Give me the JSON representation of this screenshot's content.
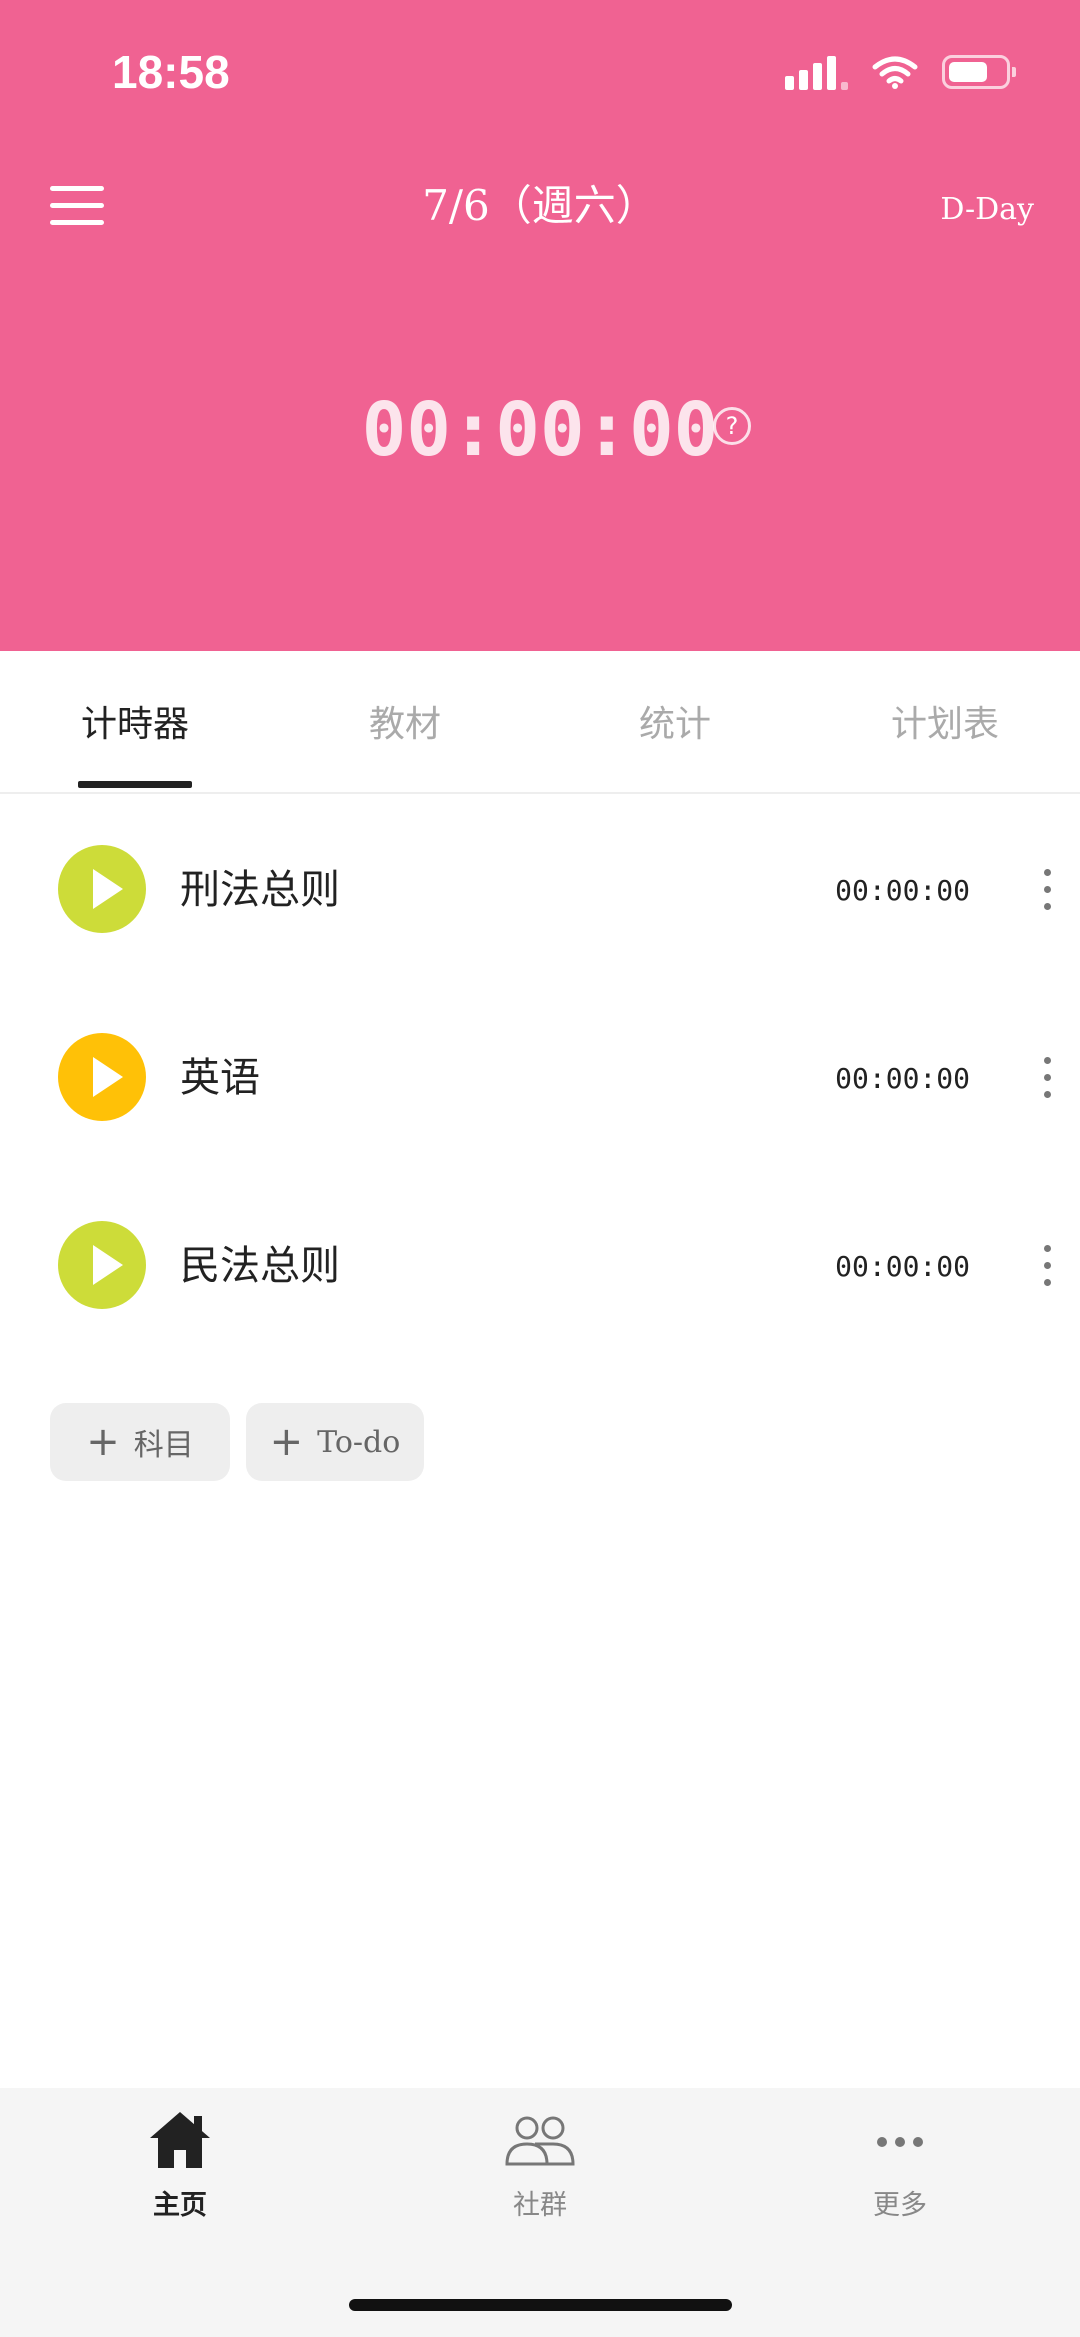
{
  "status_bar": {
    "time": "18:58"
  },
  "header": {
    "date_title": "7/6（週六）",
    "dday_label": "D-Day",
    "timer": "00:00:00",
    "help_symbol": "?",
    "background_color": "#F06292"
  },
  "tabs": [
    {
      "label": "计時器",
      "active": true
    },
    {
      "label": "教材",
      "active": false
    },
    {
      "label": "统计",
      "active": false
    },
    {
      "label": "计划表",
      "active": false
    }
  ],
  "subjects": [
    {
      "name": "刑法总则",
      "time": "00:00:00",
      "color": "#CDDC39"
    },
    {
      "name": "英语",
      "time": "00:00:00",
      "color": "#FFC107"
    },
    {
      "name": "民法总则",
      "time": "00:00:00",
      "color": "#CDDC39"
    }
  ],
  "actions": {
    "add_subject": "科目",
    "add_todo": "To-do",
    "plus_symbol": "+"
  },
  "bottom_nav": [
    {
      "label": "主页",
      "icon": "home-icon",
      "active": true
    },
    {
      "label": "社群",
      "icon": "community-icon",
      "active": false
    },
    {
      "label": "更多",
      "icon": "more-icon",
      "active": false
    }
  ]
}
